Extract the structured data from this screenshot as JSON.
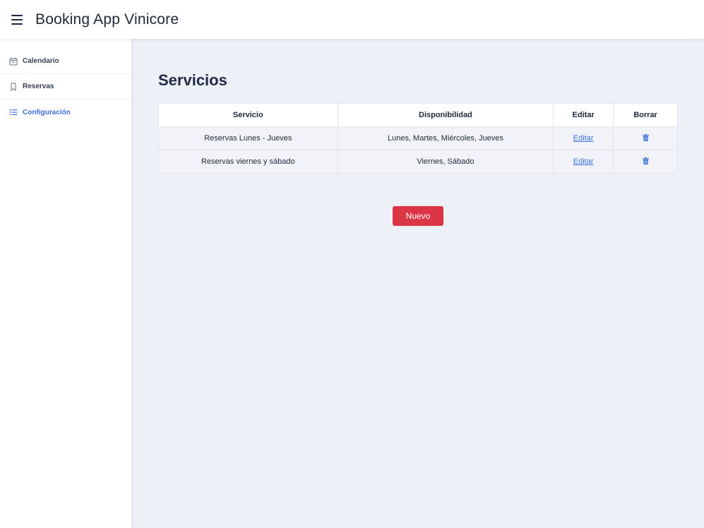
{
  "app": {
    "title": "Booking App Vinicore"
  },
  "sidebar": {
    "items": [
      {
        "label": "Calendario",
        "icon": "calendar-icon",
        "active": false
      },
      {
        "label": "Reservas",
        "icon": "bookmark-icon",
        "active": false
      },
      {
        "label": "Configuración",
        "icon": "list-icon",
        "active": true
      }
    ]
  },
  "main": {
    "title": "Servicios",
    "table": {
      "headers": [
        "Servicio",
        "Disponibilidad",
        "Editar",
        "Borrar"
      ],
      "rows": [
        {
          "servicio": "Reservas Lunes - Jueves",
          "disponibilidad": "Lunes, Martes, Miércoles, Jueves",
          "editar": "Editar"
        },
        {
          "servicio": "Reservas viernes y sábado",
          "disponibilidad": "Viernes, Sábado",
          "editar": "Editar"
        }
      ]
    },
    "new_button": "Nuevo"
  },
  "colors": {
    "accent": "#3b6fd8",
    "danger": "#dc3545",
    "main_bg": "#eef0f7"
  }
}
